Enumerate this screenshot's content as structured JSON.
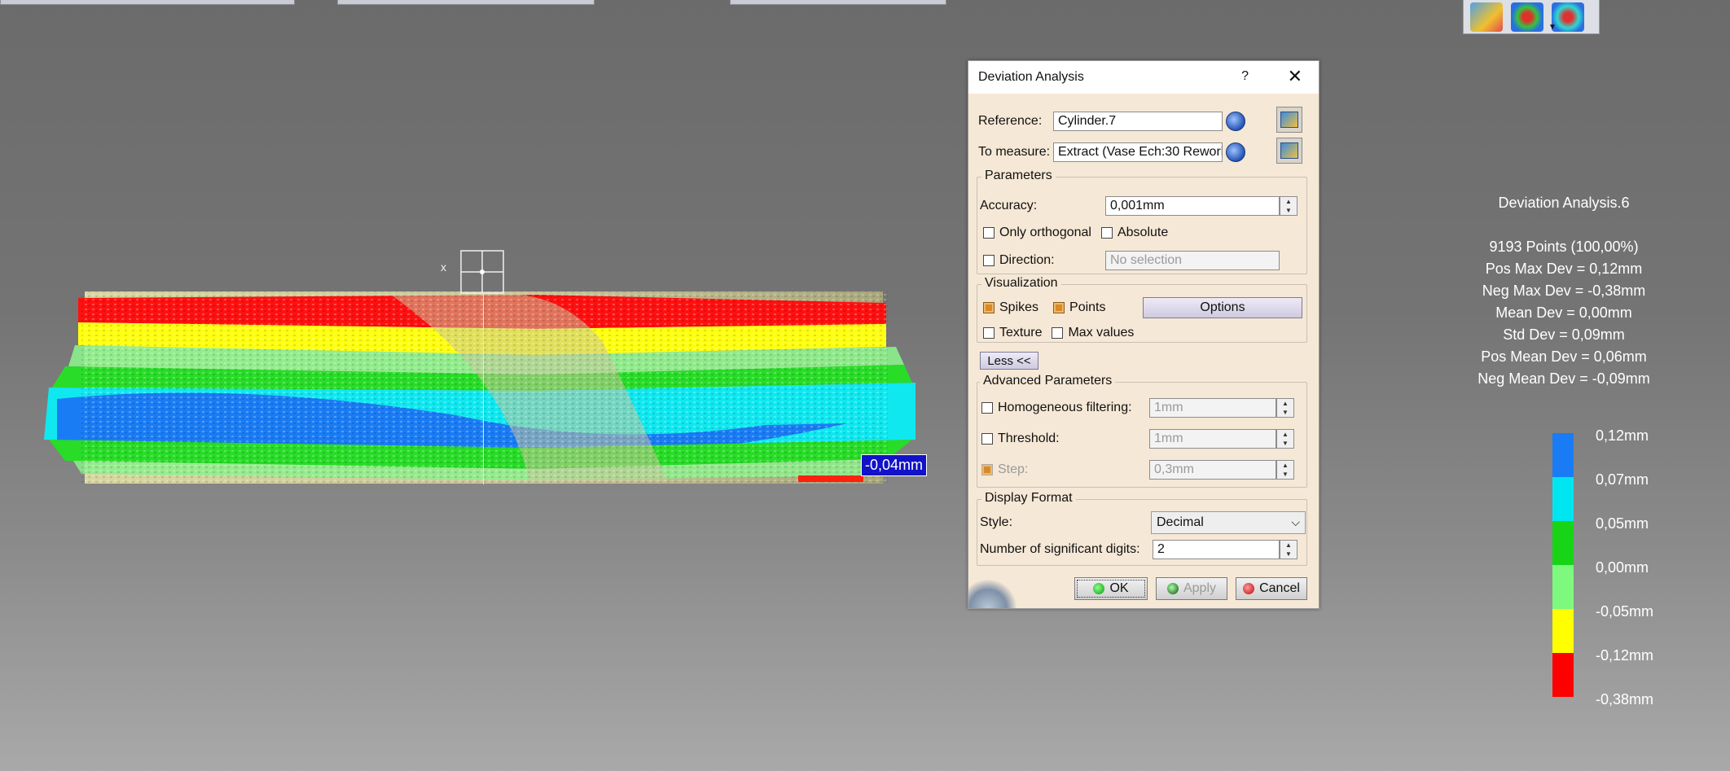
{
  "dialog": {
    "title": "Deviation Analysis",
    "help": "?",
    "close": "✕",
    "reference_label": "Reference:",
    "reference_value": "Cylinder.7",
    "to_measure_label": "To measure:",
    "to_measure_value": "Extract (Vase Ech:30 Rework",
    "parameters_title": "Parameters",
    "accuracy_label": "Accuracy:",
    "accuracy_value": "0,001mm",
    "only_orthogonal": "Only orthogonal",
    "absolute": "Absolute",
    "direction_label": "Direction:",
    "direction_value": "No selection",
    "visualization_title": "Visualization",
    "spikes": "Spikes",
    "points": "Points",
    "options_button": "Options",
    "texture": "Texture",
    "max_values": "Max values",
    "less_button": "Less <<",
    "advanced_title": "Advanced Parameters",
    "homogeneous_label": "Homogeneous filtering:",
    "homogeneous_value": "1mm",
    "threshold_label": "Threshold:",
    "threshold_value": "1mm",
    "step_label": "Step:",
    "step_value": "0,3mm",
    "display_format_title": "Display Format",
    "style_label": "Style:",
    "style_value": "Decimal",
    "digits_label": "Number of significant digits:",
    "digits_value": "2",
    "ok_button": "OK",
    "apply_button": "Apply",
    "cancel_button": "Cancel"
  },
  "viewport": {
    "axis_label": "x",
    "deviation_label": "-0,04mm"
  },
  "info": {
    "title": "Deviation Analysis.6",
    "points": "9193 Points (100,00%)",
    "pos_max": "Pos Max Dev = 0,12mm",
    "neg_max": "Neg Max Dev = -0,38mm",
    "mean": "Mean Dev = 0,00mm",
    "std": "Std Dev = 0,09mm",
    "pos_mean": "Pos Mean Dev = 0,06mm",
    "neg_mean": "Neg Mean Dev = -0,09mm"
  },
  "legend": {
    "colors": [
      "#1a7cf5",
      "#00e6f0",
      "#17d417",
      "#7dfa7d",
      "#ffff00",
      "#ff0000"
    ],
    "labels": [
      "0,12mm",
      "0,07mm",
      "0,05mm",
      "0,00mm",
      "-0,05mm",
      "-0,12mm",
      "-0,38mm"
    ]
  }
}
